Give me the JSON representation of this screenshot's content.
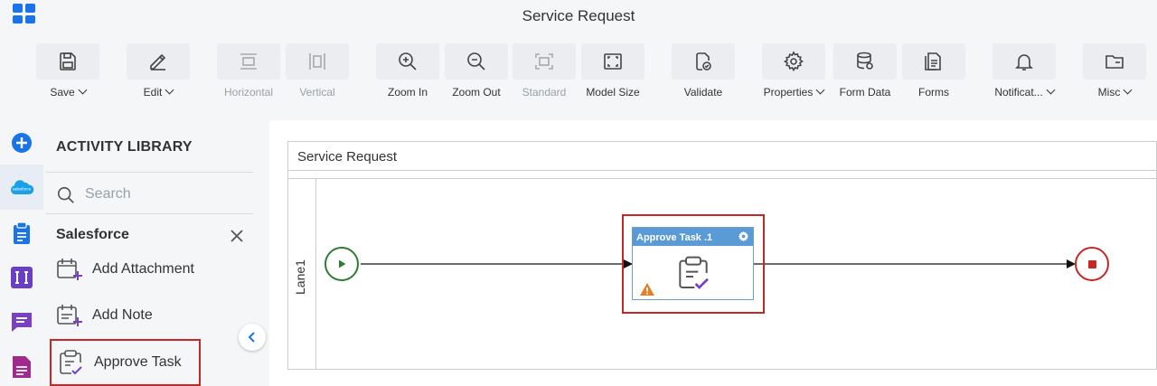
{
  "header": {
    "title": "Service Request"
  },
  "toolbar": {
    "save": "Save",
    "edit": "Edit",
    "horizontal": "Horizontal",
    "vertical": "Vertical",
    "zoom_in": "Zoom In",
    "zoom_out": "Zoom Out",
    "standard": "Standard",
    "model_size": "Model Size",
    "validate": "Validate",
    "properties": "Properties",
    "form_data": "Form Data",
    "forms": "Forms",
    "notifications": "Notificat...",
    "misc": "Misc"
  },
  "library": {
    "title": "ACTIVITY LIBRARY",
    "search_placeholder": "Search",
    "category": "Salesforce",
    "items": [
      {
        "label": "Add Attachment"
      },
      {
        "label": "Add Note"
      },
      {
        "label": "Approve Task",
        "selected": true
      }
    ]
  },
  "canvas": {
    "pool_title": "Service Request",
    "lane_label": "Lane1",
    "task_title": "Approve Task .1"
  },
  "colors": {
    "accent": "#1a73e8",
    "start": "#2e7d32",
    "end": "#c62828",
    "highlight": "#c62828",
    "task_header": "#5b9bd5",
    "purple": "#7b3fc4"
  },
  "icons": {
    "rail": [
      "plus-circle-icon",
      "salesforce-icon",
      "clipboard-icon",
      "text-field-icon",
      "chat-icon",
      "document-icon"
    ]
  }
}
